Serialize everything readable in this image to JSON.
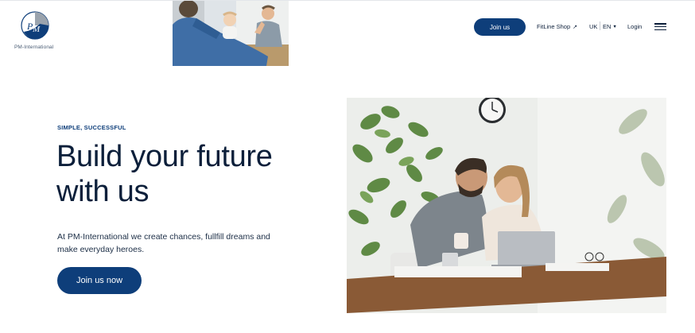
{
  "header": {
    "logo_text": "PM-International",
    "join_button": "Join us",
    "shop_link": "FitLine Shop",
    "shop_link_icon": "external-arrow-icon",
    "country": "UK",
    "language": "EN",
    "login": "Login",
    "menu_icon": "hamburger-menu-icon"
  },
  "hero": {
    "eyebrow": "SIMPLE, SUCCESSFUL",
    "headline": "Build your future with us",
    "subtext": "At PM-International we create chances, fullfill dreams and make everyday heroes.",
    "cta": "Join us now"
  },
  "colors": {
    "brand_blue": "#0e3e7a",
    "text_dark": "#0c1f3a"
  }
}
